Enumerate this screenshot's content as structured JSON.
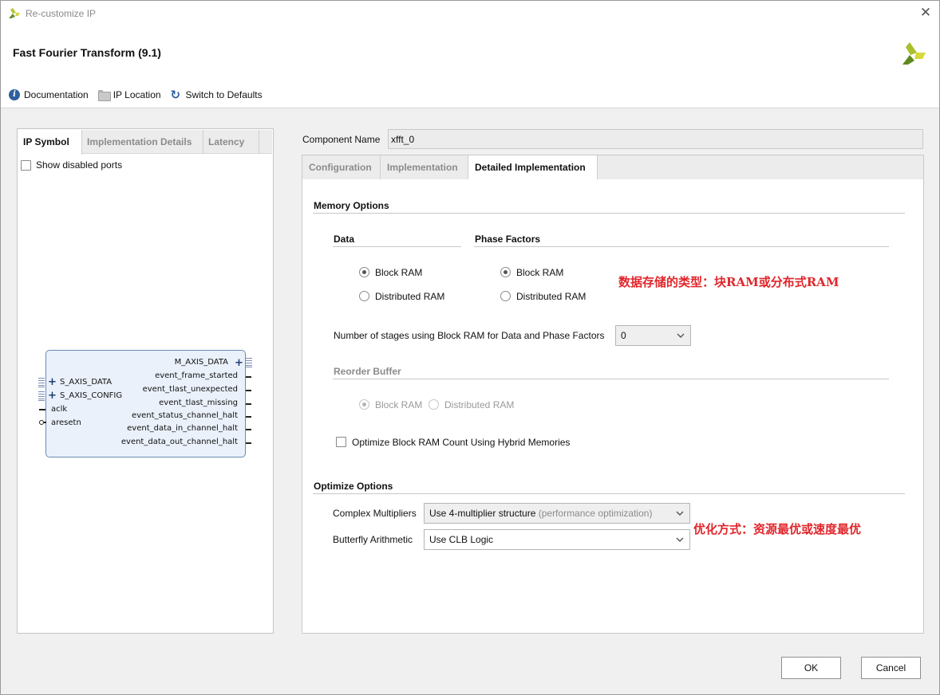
{
  "window": {
    "title": "Re-customize IP",
    "close_glyph": "✕"
  },
  "header": {
    "ip_title": "Fast Fourier Transform (9.1)",
    "toolbar": {
      "documentation": "Documentation",
      "ip_location": "IP Location",
      "switch_defaults": "Switch to Defaults"
    },
    "icons": {
      "info_glyph": "i",
      "refresh_glyph": "↻"
    }
  },
  "left": {
    "tabs": [
      "IP Symbol",
      "Implementation Details",
      "Latency"
    ],
    "show_disabled_ports": "Show disabled ports",
    "symbol": {
      "left_ports": [
        "S_AXIS_DATA",
        "S_AXIS_CONFIG",
        "aclk",
        "aresetn"
      ],
      "right_ports": [
        "M_AXIS_DATA",
        "event_frame_started",
        "event_tlast_unexpected",
        "event_tlast_missing",
        "event_status_channel_halt",
        "event_data_in_channel_halt",
        "event_data_out_channel_halt"
      ]
    }
  },
  "right": {
    "component_name_label": "Component Name",
    "component_name_value": "xfft_0",
    "tabs": [
      "Configuration",
      "Implementation",
      "Detailed Implementation"
    ],
    "memory_options": {
      "title": "Memory Options",
      "data_title": "Data",
      "phase_title": "Phase Factors",
      "data_block": "Block RAM",
      "data_dist": "Distributed RAM",
      "phase_block": "Block RAM",
      "phase_dist": "Distributed RAM",
      "stages_label": "Number of stages using Block RAM for Data and Phase Factors",
      "stages_value": "0",
      "reorder_title": "Reorder Buffer",
      "reorder_block": "Block RAM",
      "reorder_dist": "Distributed RAM",
      "hybrid_label": "Optimize Block RAM Count Using Hybrid Memories"
    },
    "optimize_options": {
      "title": "Optimize Options",
      "complex_label": "Complex Multipliers",
      "complex_value": "Use 4-multiplier structure",
      "complex_hint": "(performance optimization)",
      "butterfly_label": "Butterfly Arithmetic",
      "butterfly_value": "Use CLB Logic"
    }
  },
  "annotations": {
    "memory_note": "数据存储的类型：块RAM或分布式RAM",
    "optimize_note": "优化方式：资源最优或速度最优",
    "color": "#e1262b"
  },
  "buttons": {
    "ok": "OK",
    "cancel": "Cancel"
  }
}
